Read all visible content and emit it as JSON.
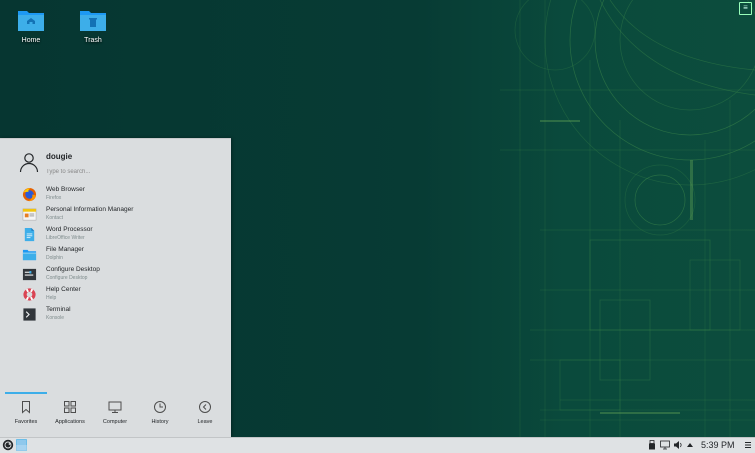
{
  "desktop": {
    "icons": [
      {
        "label": "Home",
        "icon": "folder-home-icon"
      },
      {
        "label": "Trash",
        "icon": "trash-folder-icon"
      }
    ]
  },
  "menu": {
    "username": "dougie",
    "search_placeholder": "Type to search...",
    "favorites": [
      {
        "name": "Web Browser",
        "sub": "Firefox",
        "icon": "firefox-icon"
      },
      {
        "name": "Personal Information Manager",
        "sub": "Kontact",
        "icon": "kontact-icon"
      },
      {
        "name": "Word Processor",
        "sub": "LibreOffice Writer",
        "icon": "writer-icon"
      },
      {
        "name": "File Manager",
        "sub": "Dolphin",
        "icon": "dolphin-icon"
      },
      {
        "name": "Configure Desktop",
        "sub": "Configure Desktop",
        "icon": "system-settings-icon"
      },
      {
        "name": "Help Center",
        "sub": "Help",
        "icon": "help-lifebuoy-icon"
      },
      {
        "name": "Terminal",
        "sub": "Konsole",
        "icon": "terminal-icon"
      }
    ],
    "tabs": [
      {
        "label": "Favorites",
        "icon": "bookmark-icon"
      },
      {
        "label": "Applications",
        "icon": "grid-icon"
      },
      {
        "label": "Computer",
        "icon": "monitor-icon"
      },
      {
        "label": "History",
        "icon": "clock-icon"
      },
      {
        "label": "Leave",
        "icon": "leave-arrow-icon"
      }
    ],
    "active_tab": "Favorites"
  },
  "panel": {
    "clock": "5:39 PM"
  },
  "colors": {
    "desktop_bg": "#073b34",
    "menu_bg": "#dadddf",
    "accent": "#3daee9",
    "panel_bg": "#dfe2e4"
  }
}
